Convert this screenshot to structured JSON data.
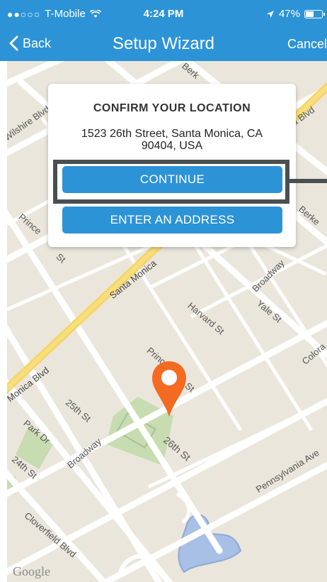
{
  "status_bar": {
    "signal_dots": "●●○○○",
    "carrier": "T-Mobile",
    "wifi": "wifi-icon",
    "time": "4:24 PM",
    "location": "location-arrow-icon",
    "battery": "47%",
    "battery_level": 0.47
  },
  "nav": {
    "back_label": "Back",
    "title": "Setup Wizard",
    "cancel_label": "Cancel"
  },
  "dialog": {
    "title": "CONFIRM YOUR LOCATION",
    "address_line1": "1523 26th Street, Santa Monica, CA",
    "address_line2": "90404, USA",
    "continue_label": "CONTINUE",
    "enter_address_label": "ENTER AN ADDRESS"
  },
  "map": {
    "streets": {
      "berkeley_top": "Berk",
      "wilshire": "Wilshire Blvd",
      "blvd_right": "a Blvd",
      "berkeley_right": "Berke",
      "princeton": "Prince",
      "princeton_st": "St",
      "santa_monica_mid": "Santa Monica",
      "broadway_right": "Broadway",
      "yale": "Yale St",
      "harvard": "Harvard St",
      "princeton_low": "Princ",
      "princeton_low2": "St",
      "colorado": "Colora",
      "monica_blvd": "Monica Blvd",
      "st25": "25th St",
      "park_dr": "Park Dr",
      "broadway_low": "Broadway",
      "st26": "26th St",
      "st24": "24th St",
      "pennsylvania": "Pennsylvania Ave",
      "cloverfield": "Cloverfield Blvd"
    },
    "attribution": "Google",
    "pin_color": "#f26b21"
  },
  "colors": {
    "accent": "#2d93d7",
    "highlight_border": "#4a4f51"
  }
}
